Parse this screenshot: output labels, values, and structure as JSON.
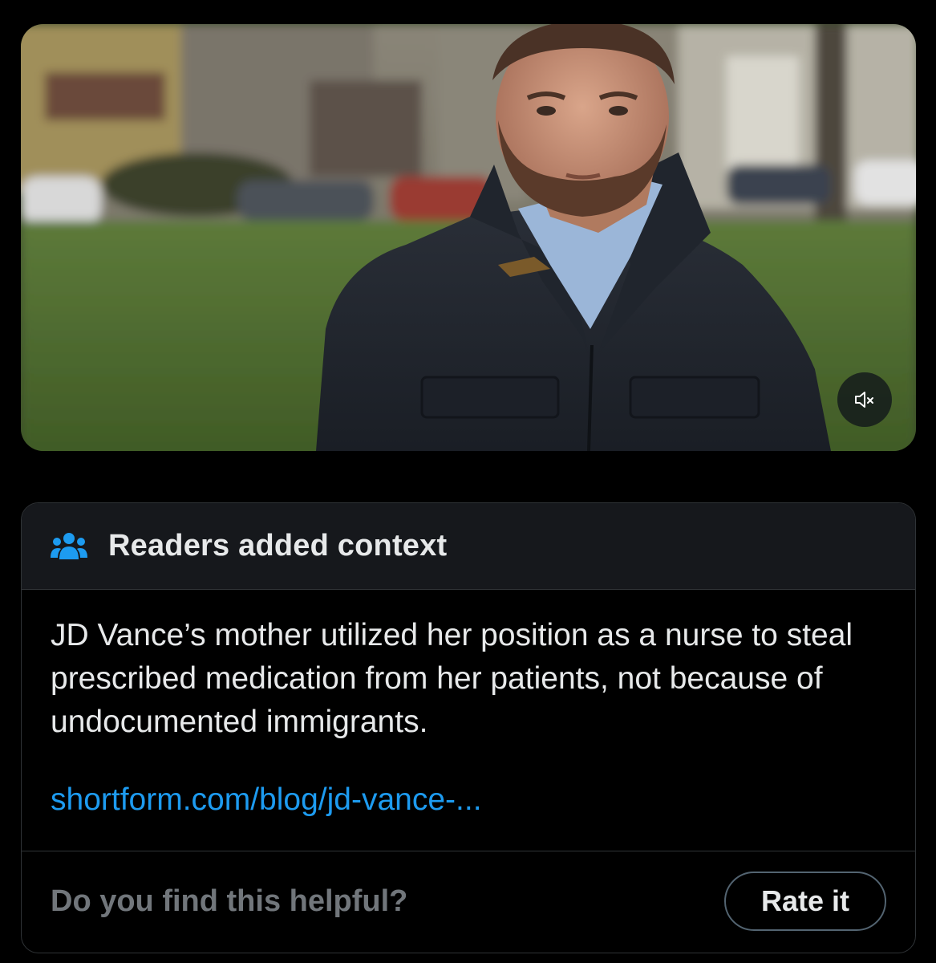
{
  "media": {
    "mute_button_icon": "volume-muted-icon"
  },
  "note": {
    "header_icon": "people-group-icon",
    "title": "Readers added context",
    "text": "JD Vance’s mother utilized her position as a nurse to steal prescribed medication from her patients, not because of undocumented immigrants.",
    "link_text": "shortform.com/blog/jd-vance-...",
    "helpful_question": "Do you find this helpful?",
    "rate_button_label": "Rate it"
  },
  "colors": {
    "background": "#000000",
    "card_header_bg": "#16181c",
    "border": "#2f3336",
    "text_primary": "#e7e9ea",
    "text_secondary": "#71767b",
    "link": "#1d9bf0",
    "icon_accent": "#1d9bf0"
  }
}
